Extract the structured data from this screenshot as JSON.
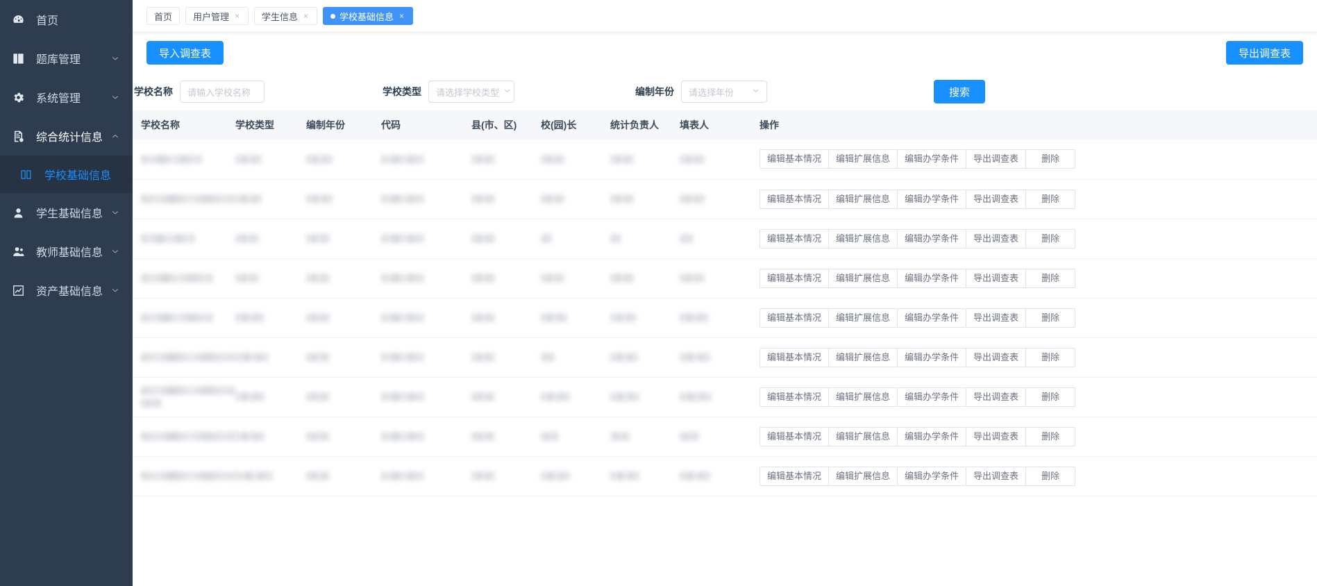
{
  "sidebar": {
    "items": [
      {
        "label": "首页",
        "icon": "dashboard-icon",
        "expandable": false,
        "active": false
      },
      {
        "label": "题库管理",
        "icon": "book-icon",
        "expandable": true,
        "active": false
      },
      {
        "label": "系统管理",
        "icon": "gear-icon",
        "expandable": true,
        "active": false
      },
      {
        "label": "综合统计信息",
        "icon": "report-icon",
        "expandable": true,
        "active": true
      },
      {
        "label": "学生基础信息",
        "icon": "user-circle-icon",
        "expandable": true,
        "active": false
      },
      {
        "label": "教师基础信息",
        "icon": "teacher-icon",
        "expandable": true,
        "active": false
      },
      {
        "label": "资产基础信息",
        "icon": "chart-box-icon",
        "expandable": true,
        "active": false
      }
    ],
    "submenu": {
      "label": "学校基础信息",
      "icon": "columns-icon"
    },
    "accent_color": "#1890ff",
    "background_color": "#2e3c50"
  },
  "tabs": [
    {
      "label": "首页",
      "closable": false,
      "active": false
    },
    {
      "label": "用户管理",
      "closable": true,
      "active": false
    },
    {
      "label": "学生信息",
      "closable": true,
      "active": false
    },
    {
      "label": "学校基础信息",
      "closable": true,
      "active": true
    }
  ],
  "tab_close_glyph": "×",
  "toolbar": {
    "import_label": "导入调查表",
    "export_label": "导出调查表",
    "primary_color": "#1890ff"
  },
  "filters": {
    "school_name": {
      "label": "学校名称",
      "placeholder": "请输入学校名称",
      "value": ""
    },
    "school_type": {
      "label": "学校类型",
      "placeholder": "请选择学校类型",
      "value": ""
    },
    "compile_year": {
      "label": "编制年份",
      "placeholder": "请选择年份",
      "value": ""
    },
    "search_label": "搜索"
  },
  "table": {
    "columns": [
      "学校名称",
      "学校类型",
      "编制年份",
      "代码",
      "县(市、区)",
      "校(园)长",
      "统计负责人",
      "填表人",
      "操作"
    ],
    "row_actions": [
      "编辑基本情况",
      "编辑扩展信息",
      "编辑办学条件",
      "导出调查表",
      "删除"
    ],
    "rows": [
      {
        "redacted": true,
        "widths": [
          88,
          38,
          38,
          62,
          34,
          34,
          34,
          36
        ],
        "lines": 1
      },
      {
        "redacted": true,
        "widths": [
          136,
          38,
          38,
          62,
          34,
          34,
          34,
          36
        ],
        "lines": 1
      },
      {
        "redacted": true,
        "widths": [
          78,
          34,
          34,
          62,
          34,
          16,
          16,
          20
        ],
        "lines": 1
      },
      {
        "redacted": true,
        "widths": [
          104,
          34,
          34,
          62,
          34,
          34,
          34,
          36
        ],
        "lines": 1
      },
      {
        "redacted": true,
        "widths": [
          104,
          42,
          34,
          62,
          34,
          38,
          38,
          42,
          44
        ],
        "lines": 1
      },
      {
        "redacted": true,
        "widths": [
          136,
          48,
          34,
          62,
          34,
          20,
          40,
          44
        ],
        "lines": 1
      },
      {
        "redacted": true,
        "widths": [
          136,
          42,
          34,
          62,
          34,
          42,
          42,
          46
        ],
        "lines": 2
      },
      {
        "redacted": true,
        "widths": [
          136,
          42,
          34,
          62,
          34,
          26,
          28,
          28
        ],
        "lines": 1
      },
      {
        "redacted": true,
        "widths": [
          136,
          54,
          34,
          62,
          34,
          42,
          42,
          44
        ],
        "lines": 1
      }
    ]
  }
}
